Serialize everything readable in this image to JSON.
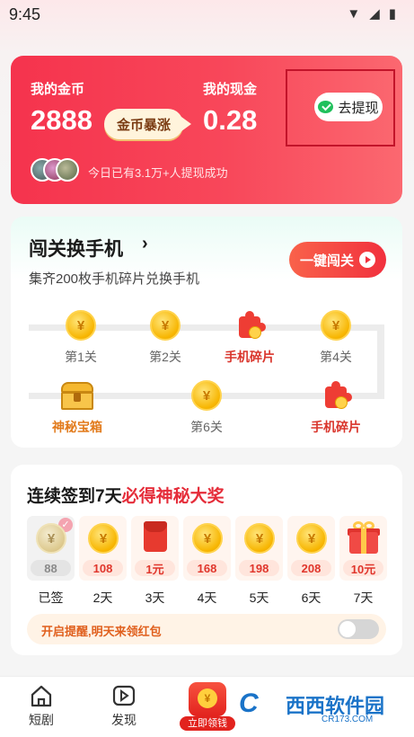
{
  "status_bar": {
    "time": "9:45"
  },
  "wallet": {
    "coins_label": "我的金币",
    "coins_value": "2888",
    "boost_label": "金币暴涨",
    "cash_label": "我的现金",
    "cash_value": "0.28",
    "withdraw_label": "去提现",
    "success_text": "今日已有3.1万+人提现成功"
  },
  "challenge": {
    "title": "闯关换手机",
    "subtitle": "集齐200枚手机碎片兑换手机",
    "button_label": "一键闯关",
    "levels": [
      {
        "label": "第1关",
        "type": "coin"
      },
      {
        "label": "第2关",
        "type": "coin"
      },
      {
        "label": "手机碎片",
        "type": "puzzle"
      },
      {
        "label": "第4关",
        "type": "coin"
      },
      {
        "label": "神秘宝箱",
        "type": "chest"
      },
      {
        "label": "第6关",
        "type": "coin"
      },
      {
        "label": "手机碎片",
        "type": "puzzle"
      }
    ],
    "coin_symbol": "¥"
  },
  "signin": {
    "title_prefix": "连续签到7天",
    "title_highlight": "必得神秘大奖",
    "days": [
      {
        "amount": "88",
        "label": "已签"
      },
      {
        "amount": "108",
        "label": "2天"
      },
      {
        "amount": "1元",
        "label": "3天"
      },
      {
        "amount": "168",
        "label": "4天"
      },
      {
        "amount": "198",
        "label": "5天"
      },
      {
        "amount": "208",
        "label": "6天"
      },
      {
        "amount": "10元",
        "label": "7天"
      }
    ],
    "reminder_text": "开启提醒,明天来领红包",
    "reminder_on": false
  },
  "bottom_nav": {
    "items": [
      {
        "label": "短剧",
        "icon": "home-icon"
      },
      {
        "label": "发现",
        "icon": "play-icon"
      }
    ],
    "center_label": "立即领钱"
  },
  "watermark": {
    "logo": "C",
    "text": "西西软件园",
    "url": "CR173.COM"
  },
  "colors": {
    "brand_red": "#f5334d",
    "accent_orange": "#e0601e",
    "coin_gold": "#f7b500"
  }
}
